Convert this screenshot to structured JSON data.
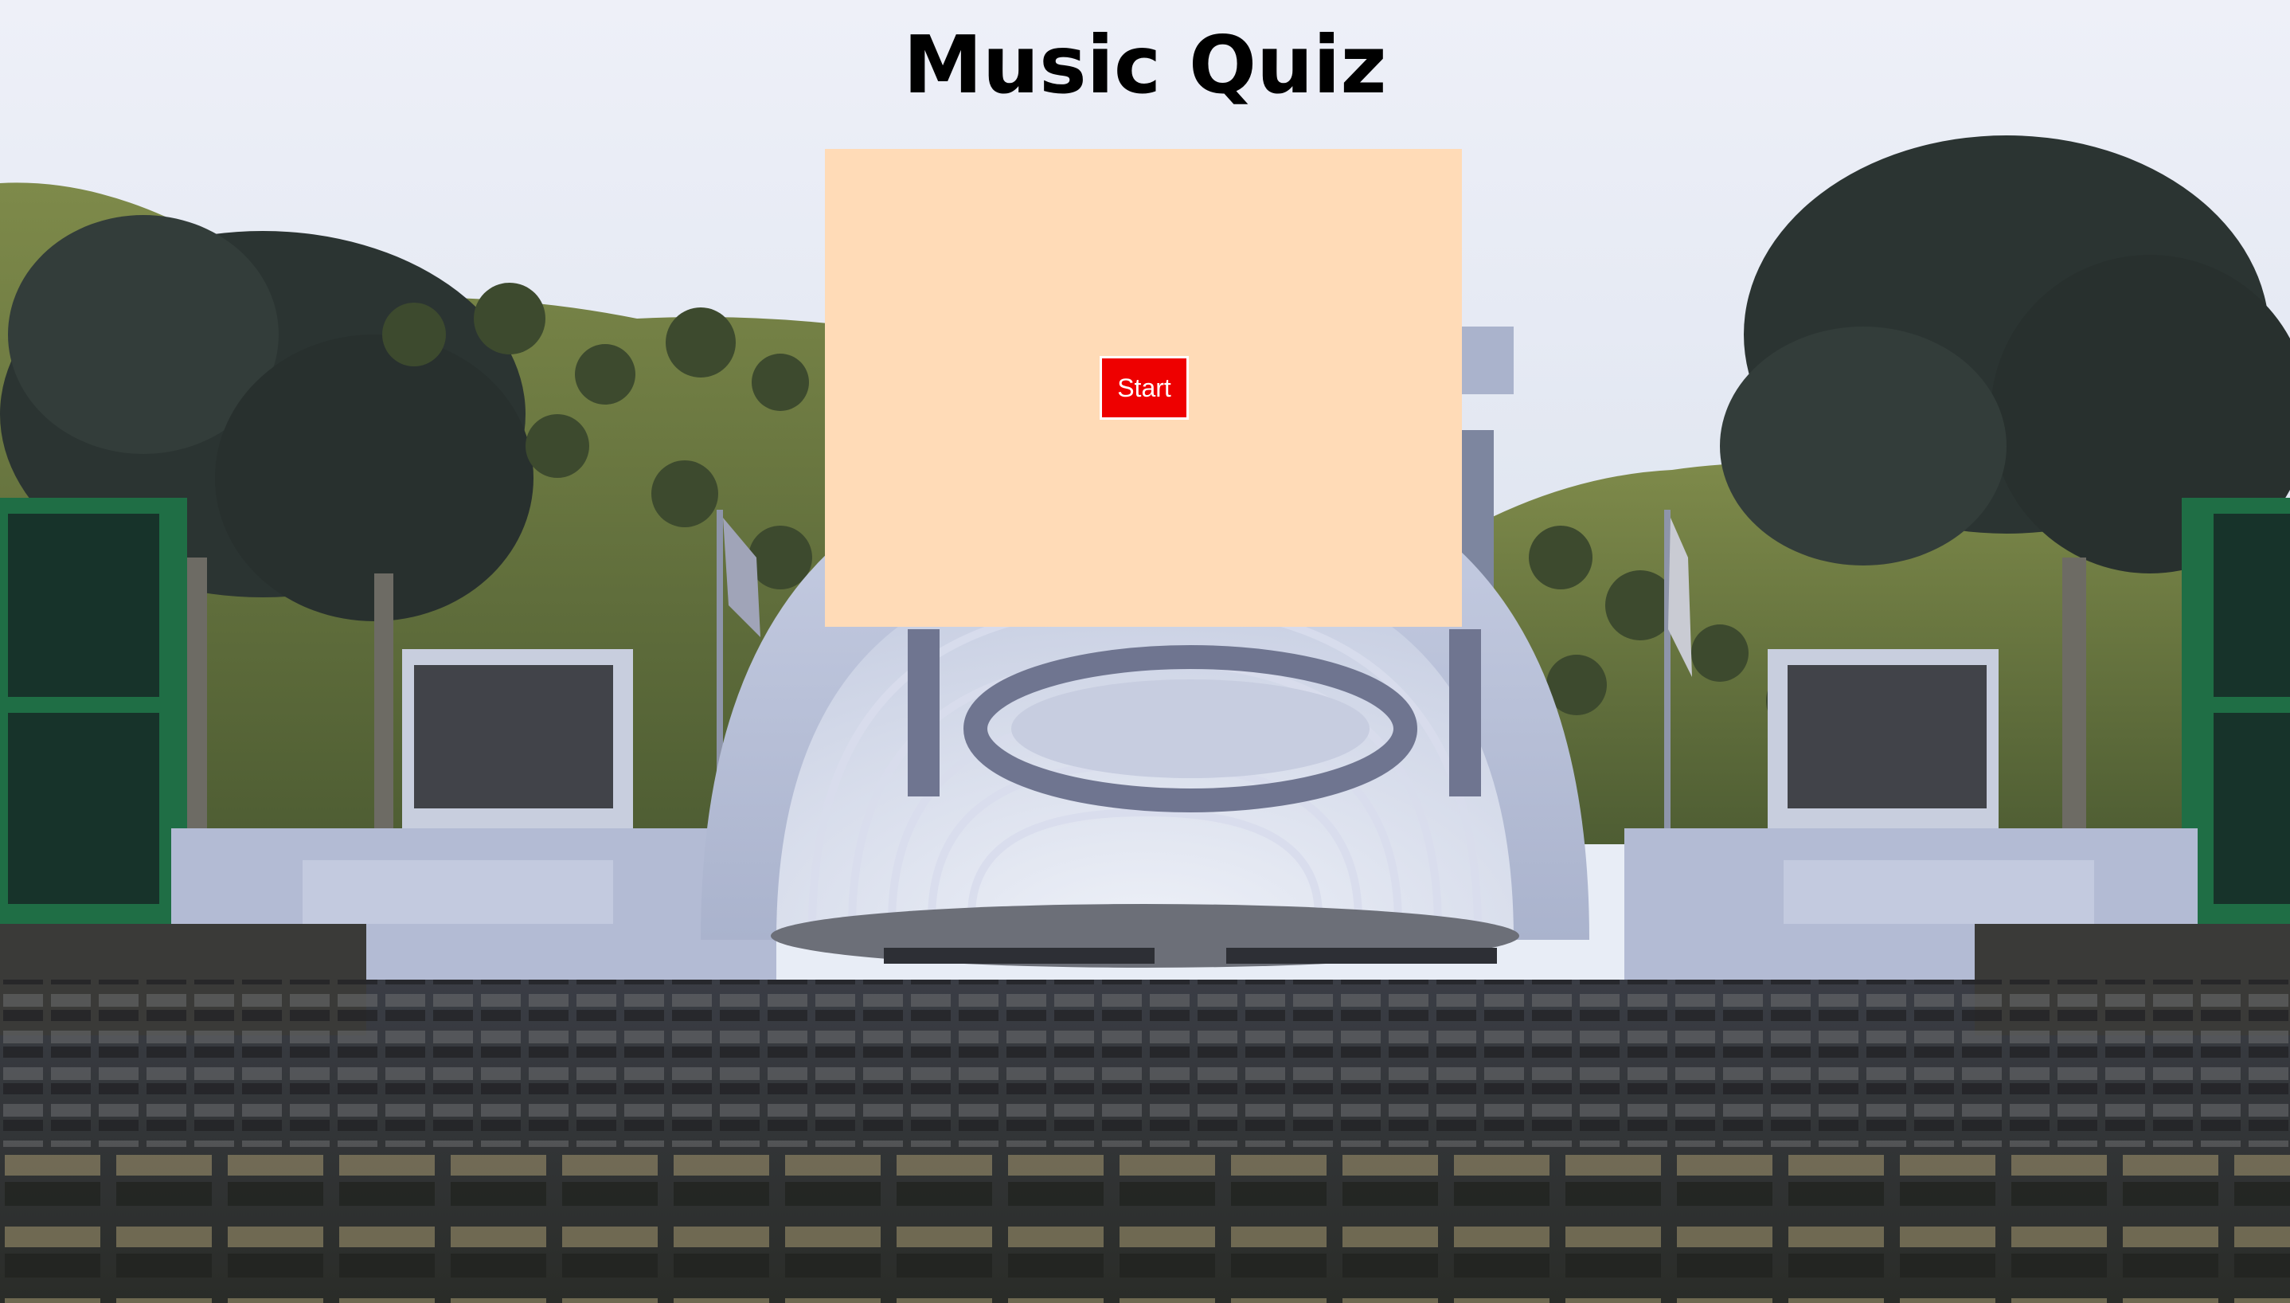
{
  "page": {
    "title": "Music Quiz"
  },
  "quiz": {
    "start_label": "Start",
    "panel_color": "#ffdbb7",
    "button_color": "#ee0000"
  },
  "background": {
    "scene": "outdoor amphitheater with band shell, trees and seating"
  }
}
